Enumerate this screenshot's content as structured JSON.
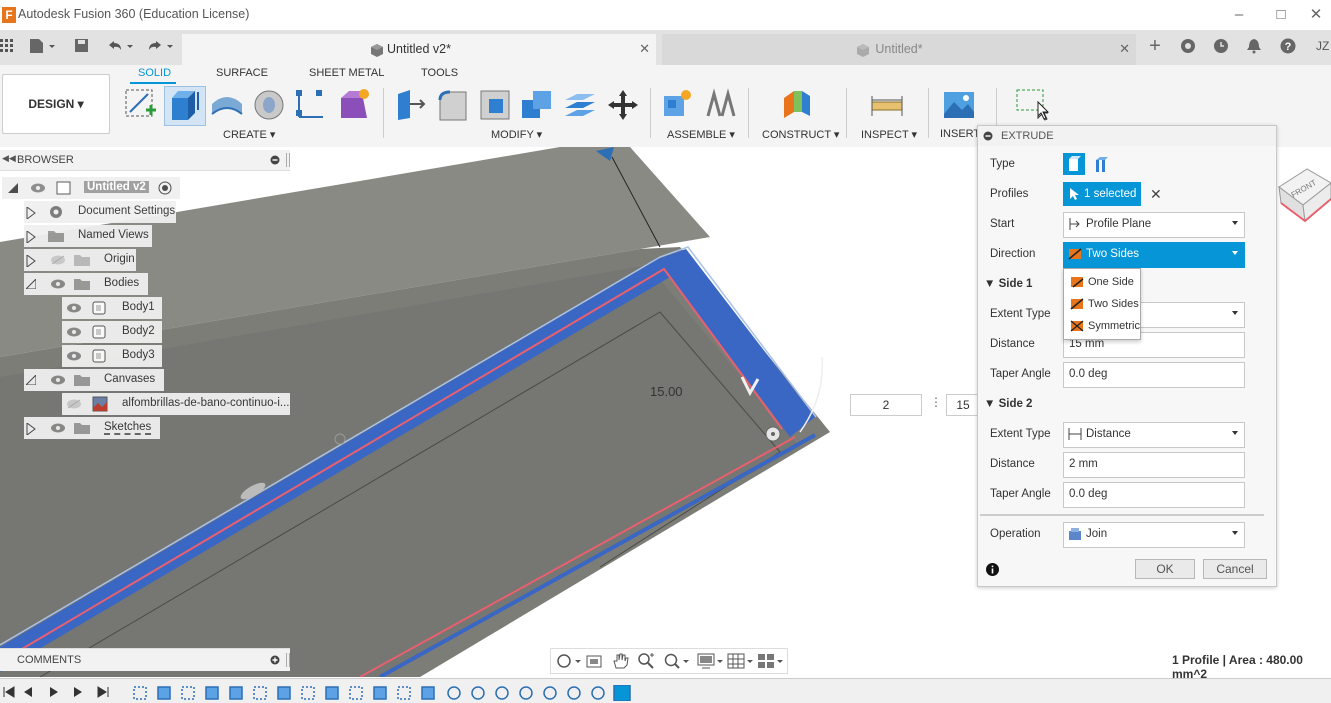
{
  "app": {
    "logo": "F",
    "title": "Autodesk Fusion 360 (Education License)"
  },
  "window_controls": {
    "minimize": "–",
    "maximize": "□",
    "close": "✕"
  },
  "tabs": [
    {
      "label": "Untitled v2*",
      "close": "✕"
    },
    {
      "label": "Untitled*",
      "close": "✕"
    }
  ],
  "tabbar_icons": [
    "plus-icon",
    "refresh-icon",
    "clock-icon",
    "bell-icon",
    "help-icon"
  ],
  "tabbar_extras": {
    "plus": "+",
    "user": "JZ"
  },
  "ribbon": {
    "workspace": "DESIGN ▾",
    "tabs": [
      "SOLID",
      "SURFACE",
      "SHEET METAL",
      "TOOLS"
    ],
    "groups": [
      "CREATE ▾",
      "MODIFY ▾",
      "ASSEMBLE ▾",
      "CONSTRUCT ▾",
      "INSPECT ▾",
      "INSERT"
    ]
  },
  "browser": {
    "header": "BROWSER",
    "items": [
      {
        "label": "Untitled v2"
      },
      {
        "label": "Document Settings"
      },
      {
        "label": "Named Views"
      },
      {
        "label": "Origin"
      },
      {
        "label": "Bodies"
      },
      {
        "label": "Body1"
      },
      {
        "label": "Body2"
      },
      {
        "label": "Body3"
      },
      {
        "label": "Canvases"
      },
      {
        "label": "alfombrillas-de-bano-continuo-i..."
      },
      {
        "label": "Sketches"
      }
    ]
  },
  "viewport": {
    "dimension": "15.00",
    "input1": "2",
    "input2": "15",
    "viewcube_label": "FRONT"
  },
  "extrude": {
    "title": "EXTRUDE",
    "type_label": "Type",
    "profiles_label": "Profiles",
    "profiles_value": "1 selected",
    "start_label": "Start",
    "start_value": "Profile Plane",
    "direction_label": "Direction",
    "direction_value": "Two Sides",
    "direction_options": [
      "One Side",
      "Two Sides",
      "Symmetric"
    ],
    "side1": {
      "header": "Side 1",
      "extent_type_label": "Extent Type",
      "distance_label": "Distance",
      "distance_value": "15 mm",
      "taper_label": "Taper Angle",
      "taper_value": "0.0 deg"
    },
    "side2": {
      "header": "Side 2",
      "extent_type_label": "Extent Type",
      "extent_type_value": "Distance",
      "distance_label": "Distance",
      "distance_value": "2 mm",
      "taper_label": "Taper Angle",
      "taper_value": "0.0 deg"
    },
    "operation_label": "Operation",
    "operation_value": "Join",
    "ok": "OK",
    "cancel": "Cancel"
  },
  "comments": {
    "header": "COMMENTS"
  },
  "status": {
    "text": "1 Profile | Area : 480.00 mm^2"
  },
  "colors": {
    "accent": "#0696d7",
    "body_blue": "#3a66c4",
    "profile_red": "#e8606f",
    "gray_body": "#7d7d78"
  }
}
